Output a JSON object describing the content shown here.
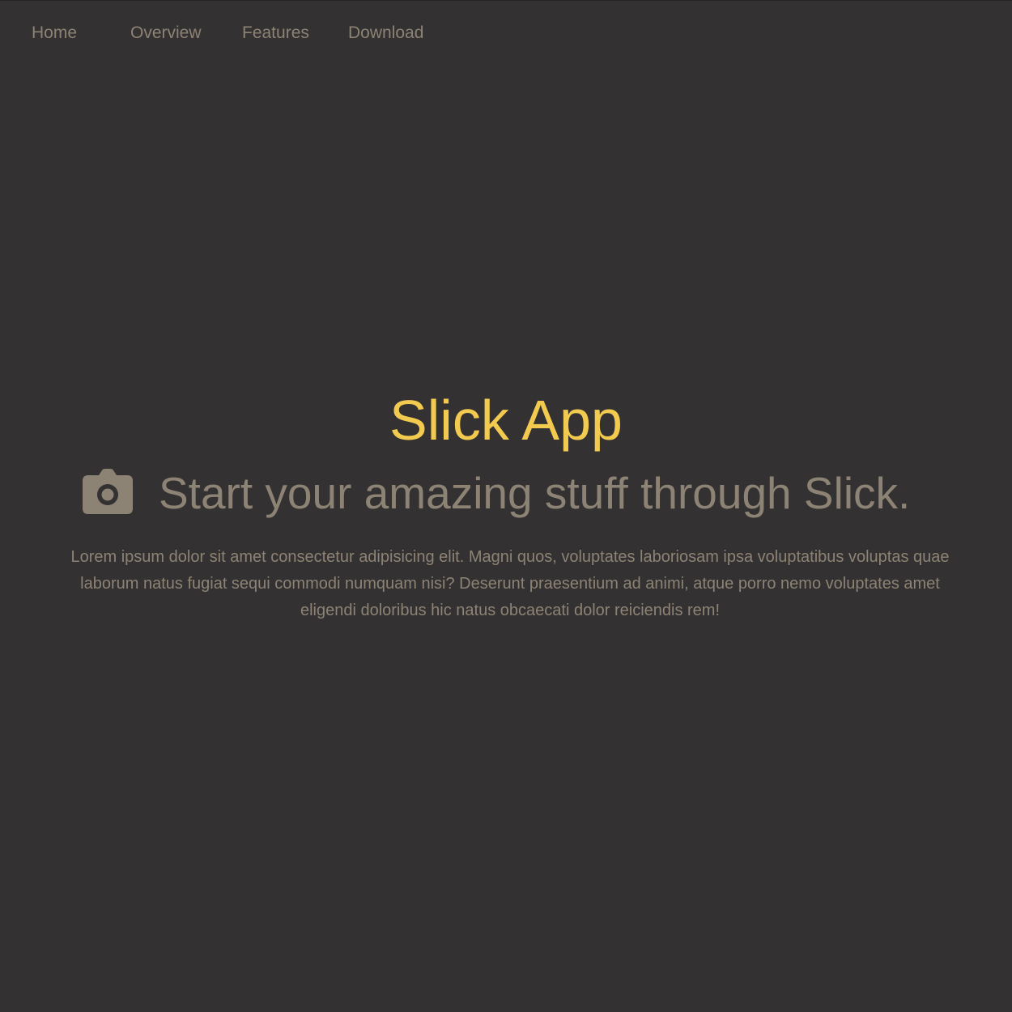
{
  "nav": {
    "items": [
      {
        "label": "Home"
      },
      {
        "label": "Overview"
      },
      {
        "label": "Features"
      },
      {
        "label": "Download"
      }
    ]
  },
  "hero": {
    "title": "Slick App",
    "icon": "camera-icon",
    "subtitle": "Start your amazing stuff through Slick.",
    "body": "Lorem ipsum dolor sit amet consectetur adipisicing elit. Magni quos, voluptates laboriosam ipsa voluptatibus voluptas quae laborum natus fugiat sequi commodi numquam nisi? Deserunt praesentium ad animi, atque porro nemo voluptates amet eligendi doloribus hic natus obcaecati dolor reiciendis rem!"
  },
  "colors": {
    "background": "#333132",
    "accent": "#f2ca4f",
    "text": "#8d8374"
  }
}
